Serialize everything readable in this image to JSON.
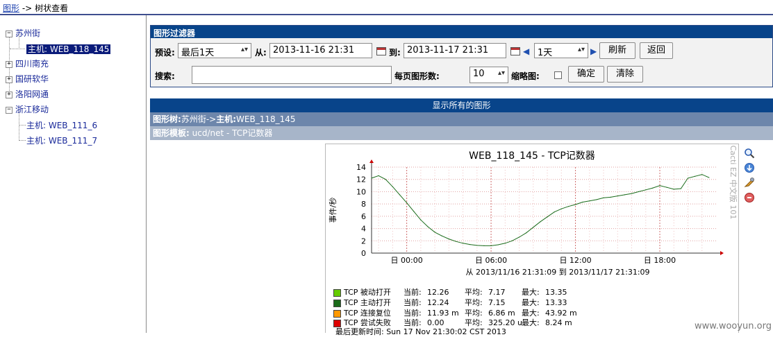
{
  "breadcrumb": {
    "graphs": "图形",
    "sep": "->",
    "current": "树状查看"
  },
  "tree": {
    "items": [
      {
        "label": "苏州街",
        "expanded": true
      },
      {
        "label": "主机: WEB_118_145",
        "selected": true
      },
      {
        "label": "四川南充"
      },
      {
        "label": "国研软华"
      },
      {
        "label": "洛阳网通"
      },
      {
        "label": "浙江移动",
        "expanded": true
      },
      {
        "label": "主机: WEB_111_6"
      },
      {
        "label": "主机: WEB_111_7"
      }
    ],
    "expander_plus": "+",
    "expander_minus": "−"
  },
  "filter": {
    "title": "图形过滤器",
    "preset_label": "预设:",
    "preset_value": "最后1天",
    "from_label": "从:",
    "from_value": "2013-11-16 21:31",
    "to_label": "到:",
    "to_value": "2013-11-17 21:31",
    "shift_value": "1天",
    "refresh": "刷新",
    "back": "返回",
    "search_label": "搜索:",
    "search_value": "",
    "per_page_label": "每页图形数:",
    "per_page_value": "10",
    "thumb_label": "缩略图:",
    "ok": "确定",
    "clear": "清除"
  },
  "show_all": "显示所有的图形",
  "tree_bar": {
    "prefix": "图形树:",
    "tree": "苏州街->",
    "host_prefix": "主机:",
    "host": "WEB_118_145"
  },
  "template_bar": {
    "prefix": "图形模板:",
    "value": "ucd/net - TCP记数器"
  },
  "graph": {
    "title": "WEB_118_145 - TCP记数器",
    "side_label": "Cacti EZ 中文版 101",
    "range_text": "从 2013/11/16 21:31:09 到 2013/11/17 21:31:09",
    "last_update": "最后更新时间: Sun 17 Nov 21:30:02 CST 2013",
    "legend": [
      {
        "name": "TCP 被动打开",
        "color": "#66cc00",
        "cur_label": "当前:",
        "cur": "12.26",
        "avg_label": "平均:",
        "avg": "7.17",
        "max_label": "最大:",
        "max": "13.35"
      },
      {
        "name": "TCP 主动打开",
        "color": "#1a6b1a",
        "cur_label": "当前:",
        "cur": "12.24",
        "avg_label": "平均:",
        "avg": "7.15",
        "max_label": "最大:",
        "max": "13.33"
      },
      {
        "name": "TCP 连接复位",
        "color": "#ff9900",
        "cur_label": "当前:",
        "cur": "11.93 m",
        "avg_label": "平均:",
        "avg": "6.86 m",
        "max_label": "最大:",
        "max": "43.92 m"
      },
      {
        "name": "TCP 尝试失败",
        "color": "#dd0000",
        "cur_label": "当前:",
        "cur": "0.00",
        "avg_label": "平均:",
        "avg": "325.20 u",
        "max_label": "最大:",
        "max": "8.24 m"
      }
    ],
    "icons": [
      "zoom-icon",
      "download-icon",
      "edit-icon",
      "delete-icon"
    ]
  },
  "chart_data": {
    "type": "line",
    "title": "WEB_118_145 - TCP记数器",
    "ylabel": "事件/秒",
    "xlabel": "",
    "ylim": [
      0,
      14
    ],
    "y_ticks": [
      "0",
      "2",
      "4",
      "6",
      "8",
      "10",
      "12",
      "14"
    ],
    "x_ticks": [
      "日 00:00",
      "日 06:00",
      "日 12:00",
      "日 18:00"
    ],
    "grid": true,
    "color": "#1a6b1a",
    "x_hours": [
      21.5,
      22,
      22.5,
      23,
      23.5,
      24,
      24.5,
      25,
      25.5,
      26,
      26.5,
      27,
      27.5,
      28,
      28.5,
      29,
      29.5,
      30,
      30.5,
      31,
      31.5,
      32,
      32.5,
      33,
      33.5,
      34,
      34.5,
      35,
      35.5,
      36,
      36.5,
      37,
      37.5,
      38,
      38.5,
      39,
      39.5,
      40,
      40.5,
      41,
      41.5,
      42,
      42.5,
      43,
      43.5,
      44,
      44.5,
      45,
      45.5
    ],
    "values": [
      12.2,
      12.6,
      12.0,
      10.8,
      9.5,
      8.2,
      6.8,
      5.4,
      4.3,
      3.4,
      2.8,
      2.3,
      1.9,
      1.6,
      1.4,
      1.25,
      1.2,
      1.2,
      1.35,
      1.6,
      2.0,
      2.6,
      3.3,
      4.2,
      5.1,
      5.9,
      6.7,
      7.2,
      7.6,
      7.9,
      8.3,
      8.5,
      8.7,
      9.0,
      9.1,
      9.3,
      9.5,
      9.7,
      10.0,
      10.3,
      10.6,
      11.0,
      10.7,
      10.4,
      10.5,
      12.2,
      12.5,
      12.8,
      12.3
    ]
  }
}
